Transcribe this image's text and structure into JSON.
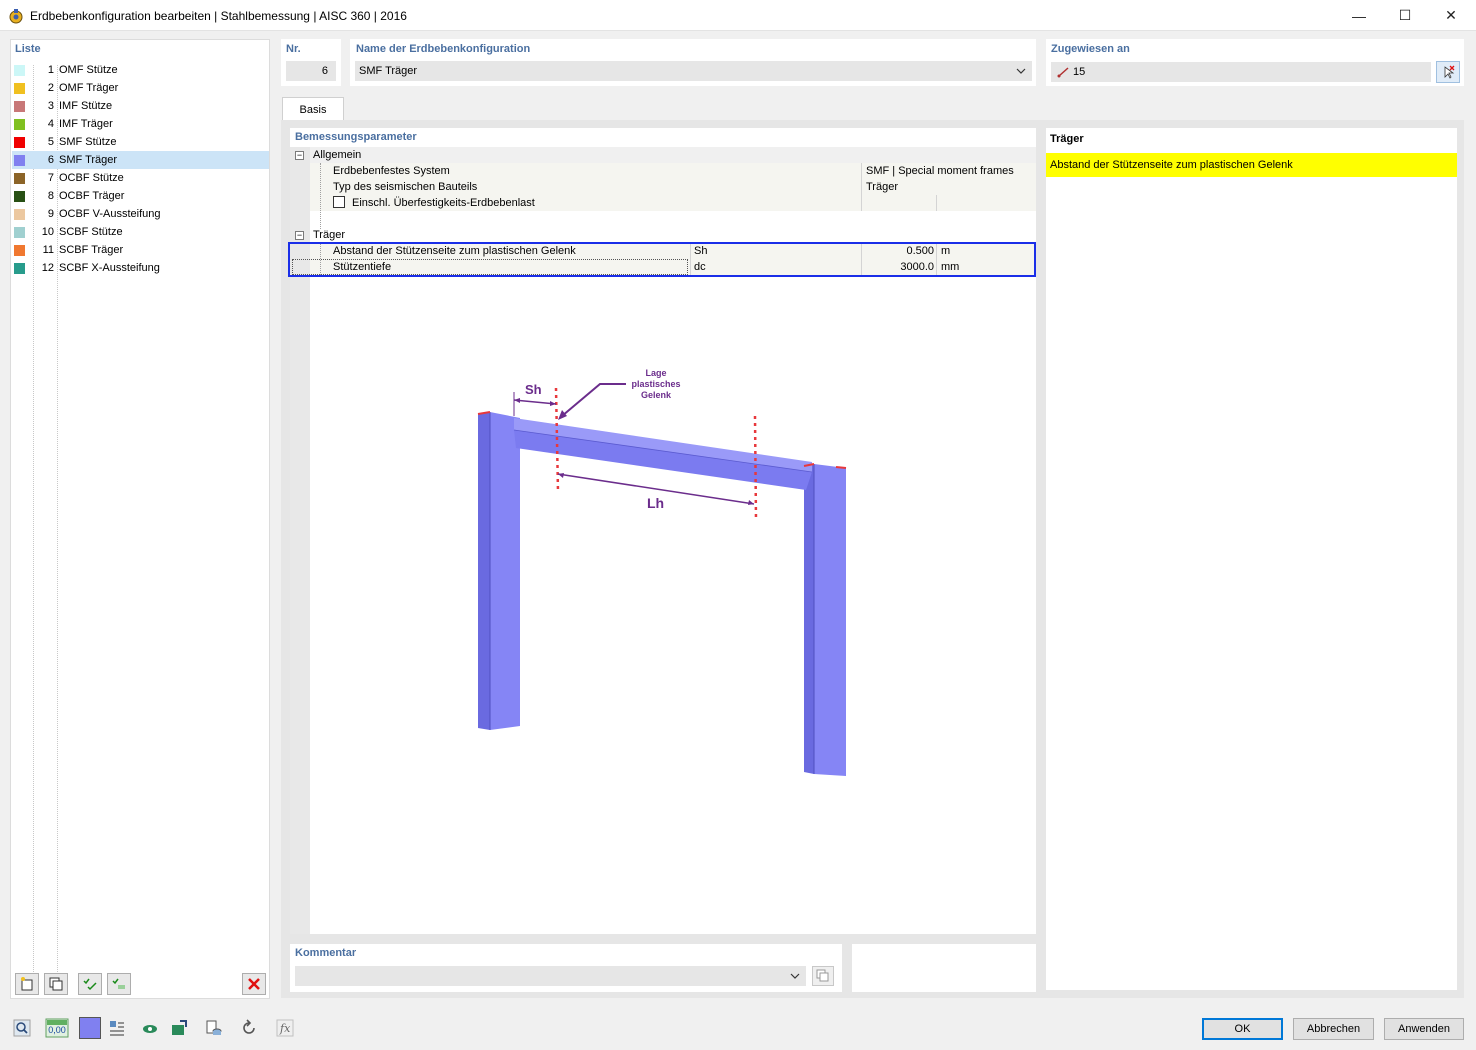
{
  "window": {
    "title": "Erdbebenkonfiguration bearbeiten | Stahlbemessung | AISC 360 | 2016",
    "minimize": "—",
    "maximize": "☐",
    "close": "✕"
  },
  "list": {
    "label": "Liste",
    "items": [
      {
        "num": "1",
        "name": "OMF Stütze",
        "color": "#ccf7f7"
      },
      {
        "num": "2",
        "name": "OMF Träger",
        "color": "#f0c020"
      },
      {
        "num": "3",
        "name": "IMF Stütze",
        "color": "#c87878"
      },
      {
        "num": "4",
        "name": "IMF Träger",
        "color": "#80c020"
      },
      {
        "num": "5",
        "name": "SMF Stütze",
        "color": "#f00000"
      },
      {
        "num": "6",
        "name": "SMF Träger",
        "color": "#8080f0"
      },
      {
        "num": "7",
        "name": "OCBF Stütze",
        "color": "#8c6428"
      },
      {
        "num": "8",
        "name": "OCBF Träger",
        "color": "#285014"
      },
      {
        "num": "9",
        "name": "OCBF V-Aussteifung",
        "color": "#ecc8a0"
      },
      {
        "num": "10",
        "name": "SCBF Stütze",
        "color": "#a0d0d0"
      },
      {
        "num": "11",
        "name": "SCBF Träger",
        "color": "#f07830"
      },
      {
        "num": "12",
        "name": "SCBF X-Aussteifung",
        "color": "#289c8c"
      }
    ],
    "selected_index": 5
  },
  "header": {
    "nr_label": "Nr.",
    "nr_value": "6",
    "name_label": "Name der Erdbebenkonfiguration",
    "name_value": "SMF Träger",
    "assigned_label": "Zugewiesen an",
    "assigned_value": "15"
  },
  "tabs": [
    {
      "label": "Basis"
    }
  ],
  "params": {
    "section_label": "Bemessungsparameter",
    "groups": {
      "allgemein": {
        "label": "Allgemein",
        "rows": [
          {
            "label": "Erdbebenfestes System",
            "value": "SMF | Special moment frames"
          },
          {
            "label": "Typ des seismischen Bauteils",
            "value": "Träger"
          },
          {
            "label": "Einschl. Überfestigkeits-Erdbebenlast",
            "checked": false
          }
        ]
      },
      "traeger": {
        "label": "Träger",
        "rows": [
          {
            "label": "Abstand der Stützenseite zum plastischen Gelenk",
            "symbol": "Sh",
            "value": "0.500",
            "unit": "m"
          },
          {
            "label": "Stützentiefe",
            "symbol": "dc",
            "value": "3000.0",
            "unit": "mm"
          }
        ]
      }
    }
  },
  "diagram": {
    "label_sh": "Sh",
    "label_lh": "Lh",
    "annotation": [
      "Lage",
      "plastisches",
      "Gelenk"
    ],
    "frame_color": "#7b7bf0",
    "marker_color": "#e8383c",
    "annotation_color": "#6b2d8c"
  },
  "info": {
    "title": "Träger",
    "highlight_text": "Abstand der Stützenseite zum plastischen Gelenk",
    "highlight_color": "#ffff00"
  },
  "comment": {
    "label": "Kommentar",
    "value": ""
  },
  "buttons": {
    "ok": "OK",
    "cancel": "Abbrechen",
    "apply": "Anwenden"
  },
  "toolbar": {
    "units_text": "0,00"
  }
}
